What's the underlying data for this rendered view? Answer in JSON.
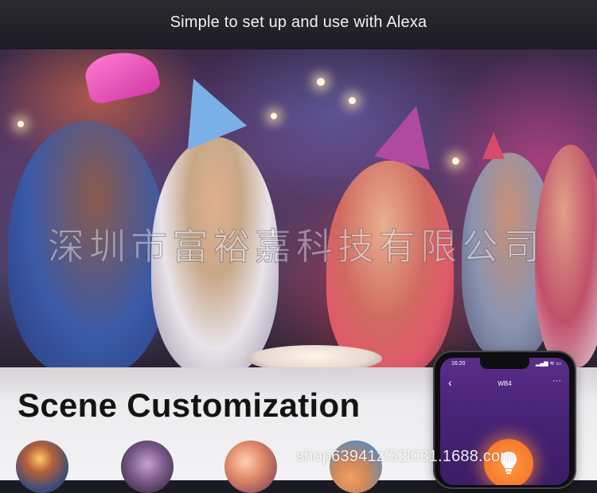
{
  "banner": {
    "title": "Simple to set up and use with Alexa"
  },
  "photo": {
    "watermark": "深圳市富裕嘉科技有限公司"
  },
  "section": {
    "title": "Scene Customization",
    "scenes": [
      {
        "icon": "scene-outdoor-lights-icon"
      },
      {
        "icon": "scene-bedroom-icon"
      },
      {
        "icon": "scene-party-icon"
      },
      {
        "icon": "scene-sunset-icon"
      }
    ]
  },
  "phone": {
    "status_time": "16:20",
    "status_icons": "▂▄▆ ≋ ▭",
    "back_symbol": "‹",
    "screen_title": "WB4",
    "more_symbol": "···"
  },
  "watermark_url": "shop63941zf32l031.1688.com",
  "colors": {
    "banner_bg": "#1c1c22",
    "phone_screen": "#4a2478",
    "bulb_button": "#f57a2a",
    "section_bg": "#f3f3f5"
  }
}
